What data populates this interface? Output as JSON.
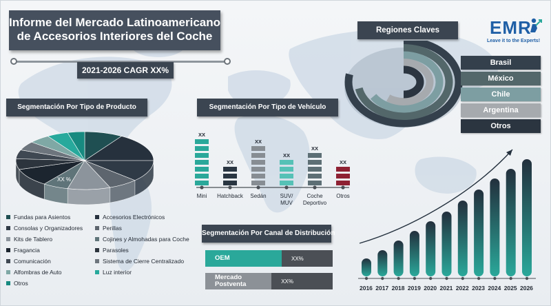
{
  "header": {
    "title_line1": "Informe del Mercado Latinoamericano",
    "title_line2": "de Accesorios Interiores del Coche",
    "cagr": "2021-2026 CAGR XX%"
  },
  "logo": {
    "text": "EMR",
    "tagline": "Leave it to the Experts!"
  },
  "product_segmentation": {
    "heading": "Segmentación Por Tipo de Producto",
    "pie_label": "XX %",
    "legend": [
      {
        "label": "Fundas para Asientos",
        "color": "#1f4f52"
      },
      {
        "label": "Accesorios Electrónicos",
        "color": "#26313d"
      },
      {
        "label": "Consolas y Organizadores",
        "color": "#2f3a46"
      },
      {
        "label": "Perillas",
        "color": "#5d656e"
      },
      {
        "label": "Kits de Tablero",
        "color": "#8c949c"
      },
      {
        "label": "Cojines y Almohadas para Coche",
        "color": "#5f7479"
      },
      {
        "label": "Fragancia",
        "color": "#1c252f"
      },
      {
        "label": "Parasoles",
        "color": "#2c343d"
      },
      {
        "label": "Comunicación",
        "color": "#3f4852"
      },
      {
        "label": "Sistema de Cierre Centralizado",
        "color": "#6d757d"
      },
      {
        "label": "Alfombras de Auto",
        "color": "#7fa8a5"
      },
      {
        "label": "Luz interior",
        "color": "#27a99c"
      },
      {
        "label": "Otros",
        "color": "#178a80"
      }
    ]
  },
  "vehicle_segmentation": {
    "heading": "Segmentación Por Tipo de Vehículo",
    "bars": [
      {
        "label": "Mini",
        "value_label": "XX",
        "blocks": 7,
        "color": "#2aa89a"
      },
      {
        "label": "Hatchback",
        "value_label": "XX",
        "blocks": 3,
        "color": "#2a3642"
      },
      {
        "label": "Sedán",
        "value_label": "XX",
        "blocks": 6,
        "color": "#878d93"
      },
      {
        "label": "SUV/\nMUV",
        "value_label": "XX",
        "blocks": 4,
        "color": "#55c1b6"
      },
      {
        "label": "Coche\nDeportivo",
        "value_label": "XX",
        "blocks": 5,
        "color": "#5d6f75"
      },
      {
        "label": "Otros",
        "value_label": "XX",
        "blocks": 3,
        "color": "#8e2133"
      }
    ]
  },
  "distribution": {
    "heading": "Segmentación Por Canal de Distribución",
    "channels": [
      {
        "label": "OEM",
        "value_label": "XX%",
        "share": 0.6,
        "color": "#2aa89a"
      },
      {
        "label": "Mercado Postventa",
        "value_label": "XX%",
        "share": 0.52,
        "color": "#8c9197"
      }
    ]
  },
  "regions": {
    "heading": "Regiones Claves",
    "items": [
      {
        "label": "Brasil",
        "color": "#34404c"
      },
      {
        "label": "México",
        "color": "#53676a"
      },
      {
        "label": "Chile",
        "color": "#7d9ea2"
      },
      {
        "label": "Argentina",
        "color": "#a6aaae"
      },
      {
        "label": "Otros",
        "color": "#2b3540"
      }
    ]
  },
  "forecast": {
    "years": [
      "2016",
      "2017",
      "2018",
      "2019",
      "2020",
      "2021",
      "2022",
      "2023",
      "2024",
      "2025",
      "2026"
    ],
    "levels": [
      0.13,
      0.19,
      0.26,
      0.33,
      0.4,
      0.47,
      0.55,
      0.63,
      0.71,
      0.78,
      0.85
    ]
  }
}
